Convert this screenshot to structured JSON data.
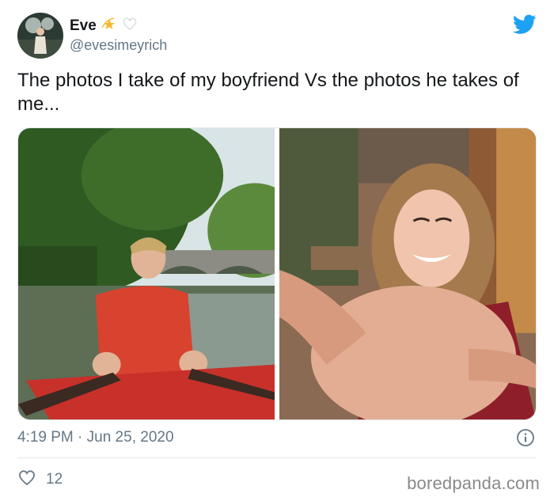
{
  "author": {
    "display_name": "Eve",
    "handle": "@evesimeyrich",
    "avatar": "profile-photo",
    "badges": [
      "dizzy-star-emoji",
      "white-heart-emoji"
    ]
  },
  "brand_icon": "twitter-bird-icon",
  "colors": {
    "twitter_blue": "#1DA1F2",
    "secondary_text": "#657786",
    "primary_text": "#14171A"
  },
  "tweet": {
    "text": "The photos I take of my boyfriend Vs the photos he takes of me...",
    "media": [
      {
        "description_icon": "photo-boyfriend-rowing-boat"
      },
      {
        "description_icon": "photo-girlfriend-selfie-hand"
      }
    ],
    "timestamp": "4:19 PM · Jun 25, 2020",
    "info_icon": "info-icon"
  },
  "engagement": {
    "like_icon": "heart-outline-icon",
    "likes": "12"
  },
  "watermark": "boredpanda.com"
}
